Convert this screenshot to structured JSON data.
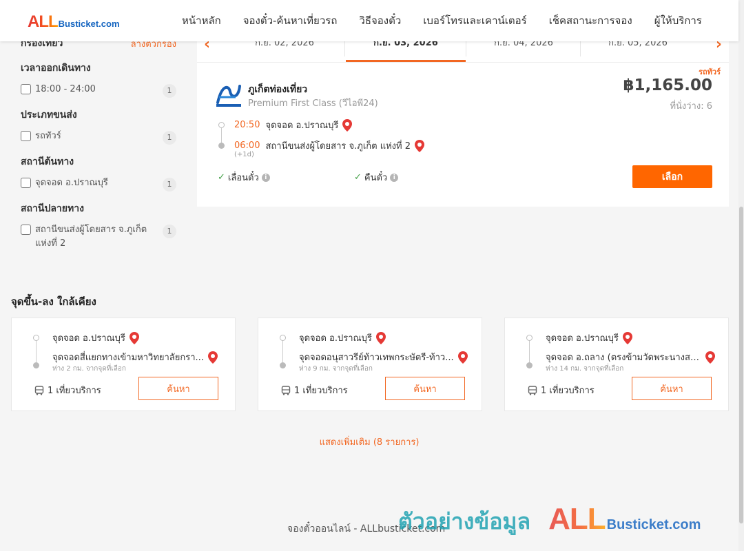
{
  "brand": {
    "logo_prefix": "ALL",
    "logo_suffix": "Busticket.com"
  },
  "nav": [
    "หน้าหลัก",
    "จองตั๋ว-ค้นหาเที่ยวรถ",
    "วิธีจองตั๋ว",
    "เบอร์โทรและเคาน์เตอร์",
    "เช็คสถานะการจอง",
    "ผู้ให้บริการ"
  ],
  "filters": {
    "title": "กรองเที่ยว",
    "clear_label": "ล้างตัวกรอง",
    "groups": [
      {
        "title": "เวลาออกเดินทาง",
        "options": [
          {
            "label": "18:00 - 24:00",
            "count": "1"
          }
        ]
      },
      {
        "title": "ประเภทขนส่ง",
        "options": [
          {
            "label": "รถทัวร์",
            "count": "1"
          }
        ]
      },
      {
        "title": "สถานีต้นทาง",
        "options": [
          {
            "label": "จุดจอด อ.ปราณบุรี",
            "count": "1"
          }
        ]
      },
      {
        "title": "สถานีปลายทาง",
        "options": [
          {
            "label": "สถานีขนส่งผู้โดยสาร จ.ภูเก็ต แห่งที่ 2",
            "count": "1"
          }
        ]
      }
    ]
  },
  "dates": {
    "items": [
      "ก.ย. 02, 2026",
      "ก.ย. 03, 2026",
      "ก.ย. 04, 2026",
      "ก.ย. 05, 2026"
    ],
    "active_index": 1
  },
  "trip": {
    "tag": "รถทัวร์",
    "operator": "ภูเก็ตท่องเที่ยว",
    "class": "Premium First Class (วีไอพี24)",
    "price": "฿1,165.00",
    "seats": "ที่นั่งว่าง: 6",
    "depart_time": "20:50",
    "depart_place": "จุดจอด อ.ปราณบุรี",
    "arrive_time": "06:00",
    "arrive_place": "สถานีขนส่งผู้โดยสาร จ.ภูเก็ต แห่งที่ 2",
    "next_day": "(+1d)",
    "feature_1": "เลื่อนตั๋ว",
    "feature_2": "คืนตั๋ว",
    "select_label": "เลือก"
  },
  "nearby": {
    "title": "จุดขึ้น-ลง ใกล้เคียง",
    "cards": [
      {
        "from": "จุดจอด อ.ปราณบุรี",
        "to": "จุดจอดสี่แยกทางเข้ามหาวิทยาลัยกรา...",
        "dist": "ห่าง 2 กม. จากจุดที่เลือก",
        "trips": "1 เที่ยวบริการ",
        "button": "ค้นหา"
      },
      {
        "from": "จุดจอด อ.ปราณบุรี",
        "to": "จุดจอดอนุสาวรีย์ท้าวเทพกระษัตรี-ท้าว...",
        "dist": "ห่าง 9 กม. จากจุดที่เลือก",
        "trips": "1 เที่ยวบริการ",
        "button": "ค้นหา"
      },
      {
        "from": "จุดจอด อ.ปราณบุรี",
        "to": "จุดจอด อ.ถลาง (ตรงข้ามวัดพระนางสร้...",
        "dist": "ห่าง 14 กม. จากจุดที่เลือก",
        "trips": "1 เที่ยวบริการ",
        "button": "ค้นหา"
      }
    ],
    "show_more": "แสดงเพิ่มเติม (8 รายการ)"
  },
  "footer": "จองตั๋วออนไลน์ - ALLbusticket.com",
  "watermark": {
    "thai": "ตัวอย่างข้อมูล",
    "prefix": "ALL",
    "suffix": "Busticket.com"
  },
  "colors": {
    "accent": "#f26722",
    "button": "#ff6600",
    "brand_blue": "#1565c0",
    "check": "#43a047"
  },
  "icons": [
    "location-pin-icon",
    "check-icon",
    "info-icon",
    "bus-icon",
    "chevron-left-icon",
    "chevron-right-icon",
    "checkbox-icon"
  ]
}
